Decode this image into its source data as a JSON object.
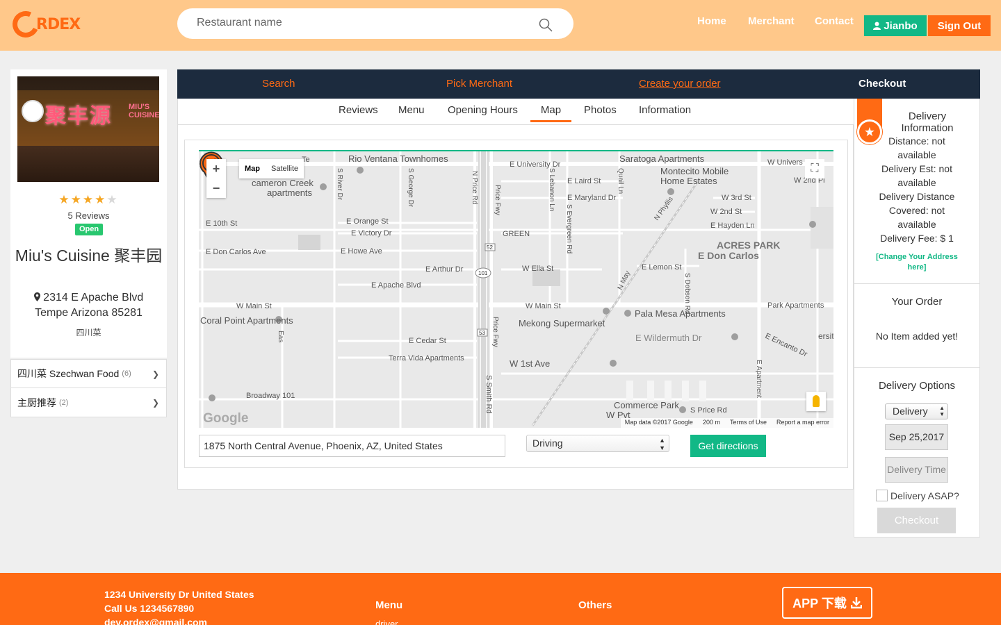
{
  "header": {
    "logo_text": "RDEX",
    "search_placeholder": "Restaurant name",
    "nav": [
      "Home",
      "Merchant",
      "Contact"
    ],
    "user_name": "Jianbo",
    "sign_out": "Sign Out"
  },
  "restaurant": {
    "rating": 4,
    "rating_max": 5,
    "reviews_label": "5 Reviews",
    "status": "Open",
    "name": "Miu's Cuisine 聚丰园",
    "address_line1": "2314 E Apache Blvd",
    "address_line2": "Tempe Arizona 85281",
    "category": "四川菜",
    "photo_sign": "聚丰源",
    "photo_sign_en": "MIU'S CUISINE"
  },
  "categories": [
    {
      "label": "四川菜 Szechwan Food",
      "count": "(6)"
    },
    {
      "label": "主厨推荐",
      "count": "(2)"
    }
  ],
  "steps": [
    "Search",
    "Pick Merchant",
    "Create your order",
    "Checkout"
  ],
  "subtabs": [
    "Reviews",
    "Menu",
    "Opening Hours",
    "Map",
    "Photos",
    "Information"
  ],
  "map": {
    "type_options": [
      "Map",
      "Satellite"
    ],
    "attribution": [
      "Map data ©2017 Google",
      "200 m",
      "Terms of Use",
      "Report a map error"
    ],
    "google_logo": "Google",
    "labels": [
      "Rio Ventana Townhomes",
      "Saratoga Apartments",
      "Montecito Mobile",
      "Home Estates",
      "cameron Creek",
      "apartments",
      "E University Dr",
      "W Univers",
      "E Laird St",
      "E Maryland Dr",
      "W 3rd St",
      "W 2nd Pl",
      "W 2nd St",
      "E Hayden Ln",
      "E 10th St",
      "E Orange St",
      "E Victory Dr",
      "GREEN",
      "ACRES PARK",
      "E Don Carlos",
      "E Don Carlos Ave",
      "E Howe Ave",
      "E Arthur Dr",
      "W Ella St",
      "E Lemon St",
      "E Apache Blvd",
      "W Main St",
      "Park Apartments",
      "Coral Point Apartments",
      "Pala Mesa Apartments",
      "Mekong Supermarket",
      "E Wildermuth Dr",
      "E Cedar St",
      "Terra Vida Apartments",
      "W 1st Ave",
      "E Encanto Dr",
      "Broadway 101",
      "Commerce Park",
      "W Pvt",
      "S Price Rd",
      "N Price Rd",
      "Price Fwy",
      "S Smith Rd",
      "S River Dr",
      "S George Dr",
      "S Lebanon Ln",
      "S Evergreen Rd",
      "Quail Ln",
      "N Phyllis",
      "N May",
      "S Dobson Rd",
      "E Apartment",
      "Eas",
      "ersity Dr",
      "Te"
    ],
    "shields": [
      "52",
      "101",
      "53"
    ],
    "directions_from": "1875 North Central Avenue, Phoenix, AZ, United States",
    "travel_mode": "Driving",
    "get_directions": "Get directions"
  },
  "sidebar": {
    "delivery_title": "Delivery Information",
    "delivery_lines": [
      "Distance: not",
      "available",
      "Delivery Est: not",
      "available",
      "Delivery Distance",
      "Covered: not",
      "available",
      "Delivery Fee: $ 1"
    ],
    "change_address": "[Change Your Address here]",
    "order_title": "Your Order",
    "order_empty": "No Item added yet!",
    "options_title": "Delivery Options",
    "delivery_type": "Delivery",
    "delivery_date": "Sep 25,2017",
    "delivery_time": "Delivery Time",
    "asap_label": "Delivery ASAP?",
    "checkout": "Checkout"
  },
  "footer": {
    "address": "1234 University Dr United States",
    "phone": "Call Us 1234567890",
    "email": "dev.ordex@gmail.com",
    "menu_title": "Menu",
    "menu_first": "driver",
    "others_title": "Others",
    "app_label": "APP 下载"
  },
  "colors": {
    "header_bg": "#ffc88a",
    "accent_orange": "#ff6a14",
    "accent_green": "#12b886",
    "progress_bg": "#1c2b3e"
  }
}
